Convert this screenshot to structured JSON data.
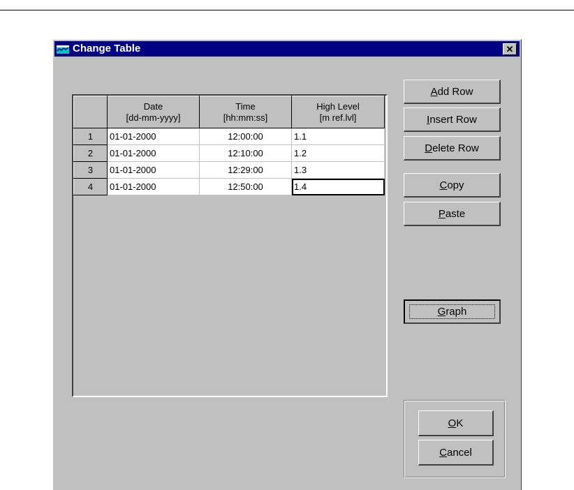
{
  "window": {
    "title": "Change Table",
    "close_glyph": "✕",
    "icon": "table-window-icon"
  },
  "table": {
    "columns": [
      {
        "line1": "Date",
        "line2": "[dd-mm-yyyy]"
      },
      {
        "line1": "Time",
        "line2": "[hh:mm:ss]"
      },
      {
        "line1": "High Level",
        "line2": "[m ref.lvl]"
      }
    ],
    "rows": [
      {
        "num": "1",
        "date": "01-01-2000",
        "time": "12:00:00",
        "level": "1.1"
      },
      {
        "num": "2",
        "date": "01-01-2000",
        "time": "12:10:00",
        "level": "1.2"
      },
      {
        "num": "3",
        "date": "01-01-2000",
        "time": "12:29:00",
        "level": "1.3"
      },
      {
        "num": "4",
        "date": "01-01-2000",
        "time": "12:50:00",
        "level": "1.4"
      }
    ]
  },
  "buttons": {
    "add_row": {
      "accel": "A",
      "rest": "dd Row"
    },
    "insert_row": {
      "accel": "I",
      "rest": "nsert Row"
    },
    "delete_row": {
      "accel": "D",
      "rest": "elete Row"
    },
    "copy": {
      "accel": "C",
      "rest": "opy"
    },
    "paste": {
      "accel": "P",
      "rest": "aste"
    },
    "graph": {
      "accel": "G",
      "rest": "raph"
    },
    "ok": {
      "accel": "O",
      "rest": "K"
    },
    "cancel": {
      "accel": "C",
      "rest": "ancel"
    }
  },
  "colors": {
    "titlebar": "#000080",
    "face": "#c0c0c0"
  }
}
